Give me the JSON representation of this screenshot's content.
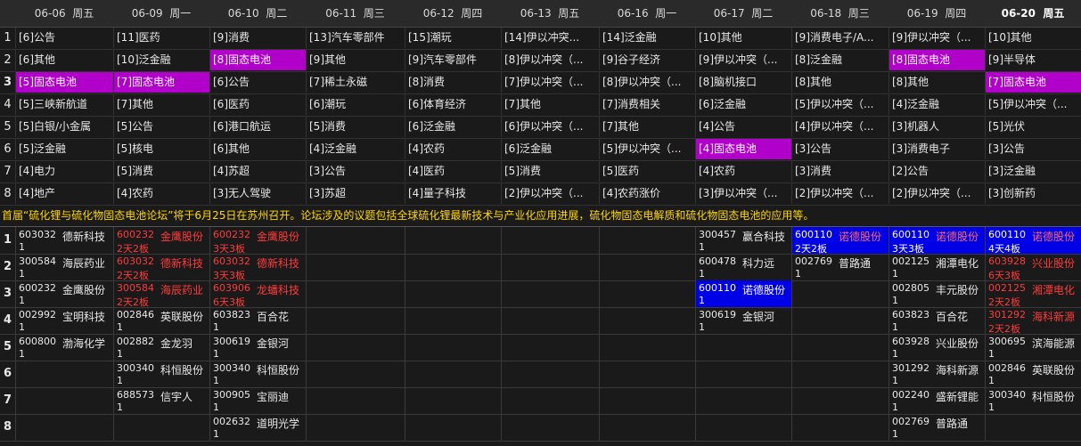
{
  "columns": [
    {
      "date": "06-06",
      "weekday": "周五"
    },
    {
      "date": "06-09",
      "weekday": "周一"
    },
    {
      "date": "06-10",
      "weekday": "周二"
    },
    {
      "date": "06-11",
      "weekday": "周三"
    },
    {
      "date": "06-12",
      "weekday": "周四"
    },
    {
      "date": "06-13",
      "weekday": "周五"
    },
    {
      "date": "06-16",
      "weekday": "周一"
    },
    {
      "date": "06-17",
      "weekday": "周二"
    },
    {
      "date": "06-18",
      "weekday": "周三"
    },
    {
      "date": "06-19",
      "weekday": "周四"
    },
    {
      "date": "06-20",
      "weekday": "周五"
    }
  ],
  "sector_rows": [
    {
      "index": "1",
      "cells": [
        {
          "text": "[6]公告"
        },
        {
          "text": "[11]医药"
        },
        {
          "text": "[9]消费"
        },
        {
          "text": "[13]汽车零部件"
        },
        {
          "text": "[15]潮玩"
        },
        {
          "text": "[14]伊以冲突..."
        },
        {
          "text": "[14]泛金融"
        },
        {
          "text": "[10]其他"
        },
        {
          "text": "[9]消费电子/A..."
        },
        {
          "text": "[9]伊以冲突（..."
        },
        {
          "text": "[10]其他"
        }
      ]
    },
    {
      "index": "2",
      "cells": [
        {
          "text": "[6]其他"
        },
        {
          "text": "[10]泛金融"
        },
        {
          "text": "[8]固态电池",
          "hl": true
        },
        {
          "text": "[9]其他"
        },
        {
          "text": "[9]汽车零部件"
        },
        {
          "text": "[8]伊以冲突（..."
        },
        {
          "text": "[9]谷子经济"
        },
        {
          "text": "[9]伊以冲突（..."
        },
        {
          "text": "[8]泛金融"
        },
        {
          "text": "[8]固态电池",
          "hl": true
        },
        {
          "text": "[9]半导体"
        }
      ]
    },
    {
      "index": "3",
      "bold": true,
      "cells": [
        {
          "text": "[5]固态电池",
          "hl": true
        },
        {
          "text": "[7]固态电池",
          "hl": true
        },
        {
          "text": "[6]公告"
        },
        {
          "text": "[7]稀土永磁"
        },
        {
          "text": "[8]消费"
        },
        {
          "text": "[7]伊以冲突（..."
        },
        {
          "text": "[8]伊以冲突（..."
        },
        {
          "text": "[8]脑机接口"
        },
        {
          "text": "[8]其他"
        },
        {
          "text": "[8]其他"
        },
        {
          "text": "[7]固态电池",
          "hl": true
        }
      ]
    },
    {
      "index": "4",
      "cells": [
        {
          "text": "[5]三峡新航道"
        },
        {
          "text": "[7]其他"
        },
        {
          "text": "[6]医药"
        },
        {
          "text": "[6]潮玩"
        },
        {
          "text": "[6]体育经济"
        },
        {
          "text": "[7]其他"
        },
        {
          "text": "[7]消费相关"
        },
        {
          "text": "[6]泛金融"
        },
        {
          "text": "[5]伊以冲突（..."
        },
        {
          "text": "[4]泛金融"
        },
        {
          "text": "[5]伊以冲突（..."
        }
      ]
    },
    {
      "index": "5",
      "cells": [
        {
          "text": "[5]白银/小金属"
        },
        {
          "text": "[5]公告"
        },
        {
          "text": "[6]港口航运"
        },
        {
          "text": "[5]消费"
        },
        {
          "text": "[6]泛金融"
        },
        {
          "text": "[6]伊以冲突（..."
        },
        {
          "text": "[7]其他"
        },
        {
          "text": "[4]公告"
        },
        {
          "text": "[4]伊以冲突（..."
        },
        {
          "text": "[3]机器人"
        },
        {
          "text": "[5]光伏"
        }
      ]
    },
    {
      "index": "6",
      "cells": [
        {
          "text": "[5]泛金融"
        },
        {
          "text": "[5]核电"
        },
        {
          "text": "[6]其他"
        },
        {
          "text": "[4]泛金融"
        },
        {
          "text": "[4]农药"
        },
        {
          "text": "[6]泛金融"
        },
        {
          "text": "[5]伊以冲突（..."
        },
        {
          "text": "[4]固态电池",
          "hl": true
        },
        {
          "text": "[3]公告"
        },
        {
          "text": "[3]消费电子"
        },
        {
          "text": "[3]公告"
        }
      ]
    },
    {
      "index": "7",
      "cells": [
        {
          "text": "[4]电力"
        },
        {
          "text": "[5]消费"
        },
        {
          "text": "[4]苏超"
        },
        {
          "text": "[3]公告"
        },
        {
          "text": "[4]医药"
        },
        {
          "text": "[5]消费"
        },
        {
          "text": "[5]医药"
        },
        {
          "text": "[4]农药"
        },
        {
          "text": "[3]消费"
        },
        {
          "text": "[2]公告"
        },
        {
          "text": "[3]泛金融"
        }
      ]
    },
    {
      "index": "8",
      "cells": [
        {
          "text": "[4]地产"
        },
        {
          "text": "[4]农药"
        },
        {
          "text": "[3]无人驾驶"
        },
        {
          "text": "[3]苏超"
        },
        {
          "text": "[4]量子科技"
        },
        {
          "text": "[2]伊以冲突（..."
        },
        {
          "text": "[4]农药涨价"
        },
        {
          "text": "[3]伊以冲突（..."
        },
        {
          "text": "[2]伊以冲突（..."
        },
        {
          "text": "[2]伊以冲突（..."
        },
        {
          "text": "[3]创新药"
        }
      ]
    }
  ],
  "news": "首届“硫化锂与硫化物固态电池论坛”将于6月25日在苏州召开。论坛涉及的议题包括全球硫化锂最新技术与产业化应用进展，硫化物固态电解质和硫化物固态电池的应用等。",
  "stock_rows": [
    {
      "index": "1",
      "cells": [
        {
          "code": "603032",
          "name": "德新科技",
          "sub": "1",
          "style": "white"
        },
        {
          "code": "600232",
          "name": "金鹰股份",
          "sub": "2天2板",
          "style": "red"
        },
        {
          "code": "600232",
          "name": "金鹰股份",
          "sub": "3天3板",
          "style": "red"
        },
        null,
        null,
        null,
        null,
        {
          "code": "300457",
          "name": "赢合科技",
          "sub": "1",
          "style": "white"
        },
        {
          "code": "600110",
          "name": "诺德股份",
          "sub": "2天2板",
          "style": "bluered"
        },
        {
          "code": "600110",
          "name": "诺德股份",
          "sub": "3天3板",
          "style": "bluered"
        },
        {
          "code": "600110",
          "name": "诺德股份",
          "sub": "4天4板",
          "style": "bluered"
        }
      ]
    },
    {
      "index": "2",
      "cells": [
        {
          "code": "300584",
          "name": "海辰药业",
          "sub": "1",
          "style": "white"
        },
        {
          "code": "603032",
          "name": "德新科技",
          "sub": "2天2板",
          "style": "red"
        },
        {
          "code": "603032",
          "name": "德新科技",
          "sub": "3天3板",
          "style": "red"
        },
        null,
        null,
        null,
        null,
        {
          "code": "600478",
          "name": "科力远",
          "sub": "1",
          "style": "white"
        },
        {
          "code": "002769",
          "name": "普路通",
          "sub": "1",
          "style": "white"
        },
        {
          "code": "002125",
          "name": "湘潭电化",
          "sub": "1",
          "style": "white"
        },
        {
          "code": "603928",
          "name": "兴业股份",
          "sub": "6天3板",
          "style": "red"
        }
      ]
    },
    {
      "index": "3",
      "cells": [
        {
          "code": "600232",
          "name": "金鹰股份",
          "sub": "1",
          "style": "white"
        },
        {
          "code": "300584",
          "name": "海辰药业",
          "sub": "2天2板",
          "style": "red"
        },
        {
          "code": "603906",
          "name": "龙蟠科技",
          "sub": "6天3板",
          "style": "red"
        },
        null,
        null,
        null,
        null,
        {
          "code": "600110",
          "name": "诺德股份",
          "sub": "1",
          "style": "blue"
        },
        null,
        {
          "code": "002805",
          "name": "丰元股份",
          "sub": "1",
          "style": "white"
        },
        {
          "code": "002125",
          "name": "湘潭电化",
          "sub": "2天2板",
          "style": "red"
        }
      ]
    },
    {
      "index": "4",
      "cells": [
        {
          "code": "002992",
          "name": "宝明科技",
          "sub": "1",
          "style": "white"
        },
        {
          "code": "002846",
          "name": "英联股份",
          "sub": "1",
          "style": "white"
        },
        {
          "code": "603823",
          "name": "百合花",
          "sub": "1",
          "style": "white"
        },
        null,
        null,
        null,
        null,
        {
          "code": "300619",
          "name": "金银河",
          "sub": "1",
          "style": "white"
        },
        null,
        {
          "code": "603823",
          "name": "百合花",
          "sub": "1",
          "style": "white"
        },
        {
          "code": "301292",
          "name": "海科新源",
          "sub": "2天2板",
          "style": "red"
        }
      ]
    },
    {
      "index": "5",
      "cells": [
        {
          "code": "600800",
          "name": "渤海化学",
          "sub": "1",
          "style": "white"
        },
        {
          "code": "002882",
          "name": "金龙羽",
          "sub": "1",
          "style": "white"
        },
        {
          "code": "300619",
          "name": "金银河",
          "sub": "1",
          "style": "white"
        },
        null,
        null,
        null,
        null,
        null,
        null,
        {
          "code": "603928",
          "name": "兴业股份",
          "sub": "1",
          "style": "white"
        },
        {
          "code": "300695",
          "name": "滨海能源",
          "sub": "1",
          "style": "white"
        }
      ]
    },
    {
      "index": "6",
      "cells": [
        null,
        {
          "code": "300340",
          "name": "科恒股份",
          "sub": "1",
          "style": "white"
        },
        {
          "code": "300340",
          "name": "科恒股份",
          "sub": "1",
          "style": "white"
        },
        null,
        null,
        null,
        null,
        null,
        null,
        {
          "code": "301292",
          "name": "海科新源",
          "sub": "1",
          "style": "white"
        },
        {
          "code": "002846",
          "name": "英联股份",
          "sub": "1",
          "style": "white"
        }
      ]
    },
    {
      "index": "7",
      "cells": [
        null,
        {
          "code": "688573",
          "name": "信宇人",
          "sub": "1",
          "style": "white"
        },
        {
          "code": "300905",
          "name": "宝丽迪",
          "sub": "1",
          "style": "white"
        },
        null,
        null,
        null,
        null,
        null,
        null,
        {
          "code": "002240",
          "name": "盛新锂能",
          "sub": "1",
          "style": "white"
        },
        {
          "code": "300340",
          "name": "科恒股份",
          "sub": "1",
          "style": "white"
        }
      ]
    },
    {
      "index": "8",
      "cells": [
        null,
        null,
        {
          "code": "002632",
          "name": "道明光学",
          "sub": "1",
          "style": "white"
        },
        null,
        null,
        null,
        null,
        null,
        null,
        {
          "code": "002769",
          "name": "普路通",
          "sub": "1",
          "style": "white"
        },
        null
      ]
    }
  ]
}
